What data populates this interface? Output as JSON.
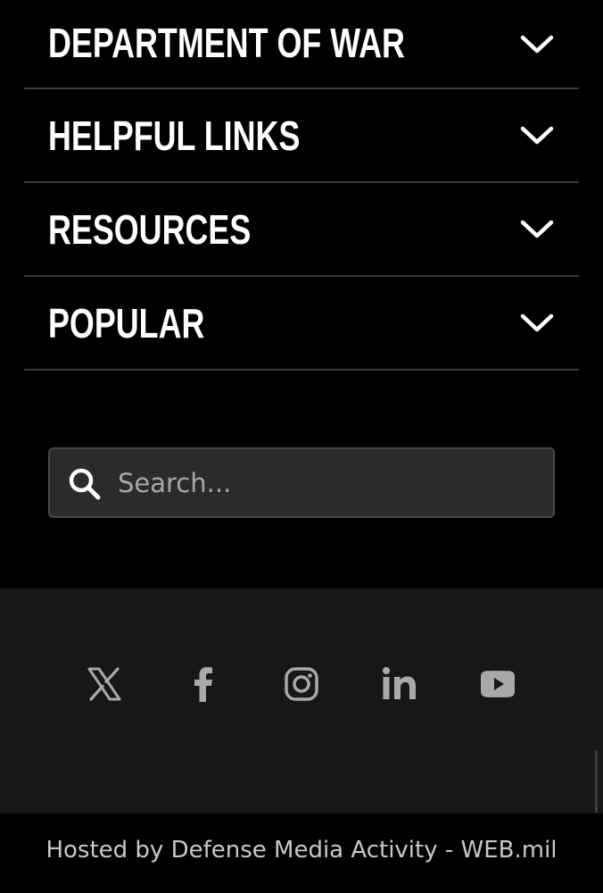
{
  "accordion": {
    "items": [
      {
        "label": "DEPARTMENT OF WAR",
        "icon": "chevron-down-icon"
      },
      {
        "label": "HELPFUL LINKS",
        "icon": "chevron-down-icon"
      },
      {
        "label": "RESOURCES",
        "icon": "chevron-down-icon"
      },
      {
        "label": "POPULAR",
        "icon": "chevron-down-icon"
      }
    ]
  },
  "search": {
    "placeholder": "Search...",
    "value": "",
    "icon": "search-icon"
  },
  "social": {
    "icons": [
      "x-icon",
      "facebook-icon",
      "instagram-icon",
      "linkedin-icon",
      "youtube-icon"
    ]
  },
  "footer": {
    "text": "Hosted by Defense Media Activity - WEB.mil"
  },
  "colors": {
    "background": "#000000",
    "social_band": "#171717",
    "search_bg": "#2b2b2b",
    "icon_gray": "#a9a9a9",
    "divider": "#3a3a3a"
  }
}
